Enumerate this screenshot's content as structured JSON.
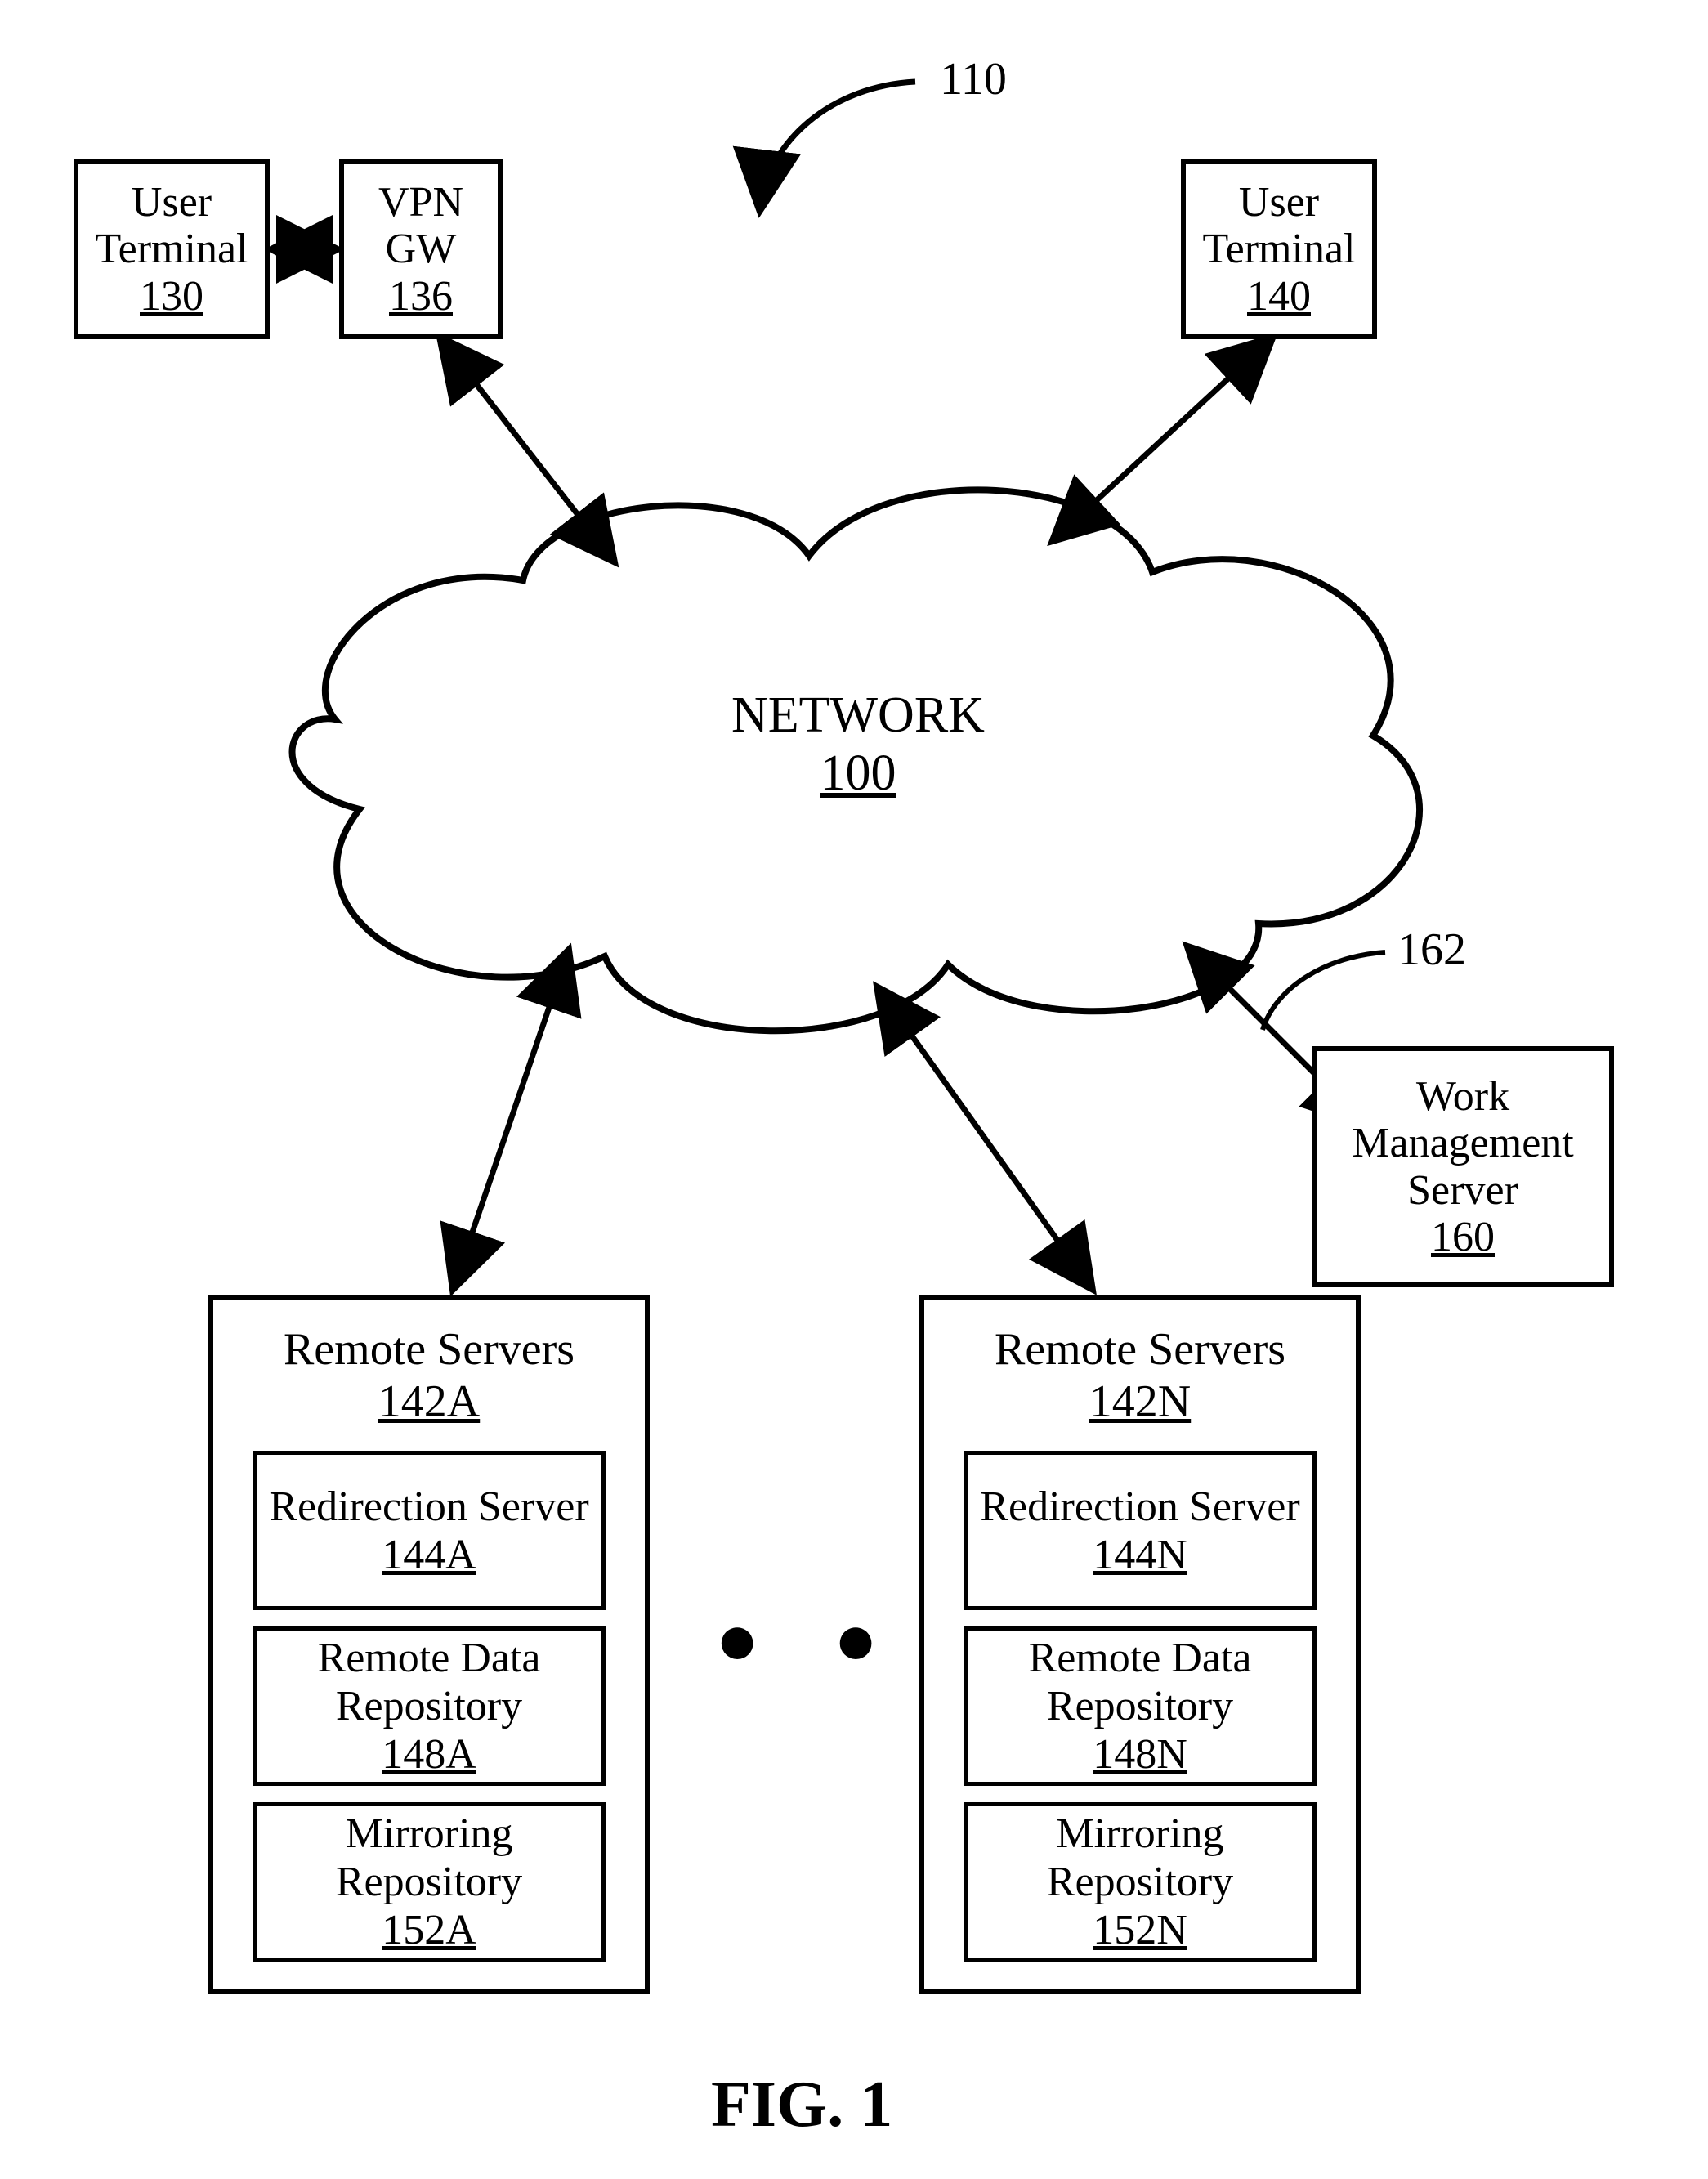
{
  "figure_label": "FIG. 1",
  "system_ref": "110",
  "network": {
    "title": "NETWORK",
    "ref": "100"
  },
  "user_terminal_left": {
    "label": "User Terminal",
    "ref": "130"
  },
  "vpn_gw": {
    "label1": "VPN",
    "label2": "GW",
    "ref": "136"
  },
  "user_terminal_right": {
    "label": "User Terminal",
    "ref": "140"
  },
  "wms": {
    "line1": "Work",
    "line2": "Management",
    "line3": "Server",
    "ref": "160",
    "callout_ref": "162"
  },
  "servers_left": {
    "title": "Remote Servers",
    "ref": "142A",
    "items": [
      {
        "label": "Redirection Server",
        "ref": "144A"
      },
      {
        "label": "Remote Data Repository",
        "ref": "148A"
      },
      {
        "label": "Mirroring Repository",
        "ref": "152A"
      }
    ]
  },
  "servers_right": {
    "title": "Remote Servers",
    "ref": "142N",
    "items": [
      {
        "label": "Redirection Server",
        "ref": "144N"
      },
      {
        "label": "Remote Data Repository",
        "ref": "148N"
      },
      {
        "label": "Mirroring Repository",
        "ref": "152N"
      }
    ]
  },
  "ellipsis": "● ● ●"
}
